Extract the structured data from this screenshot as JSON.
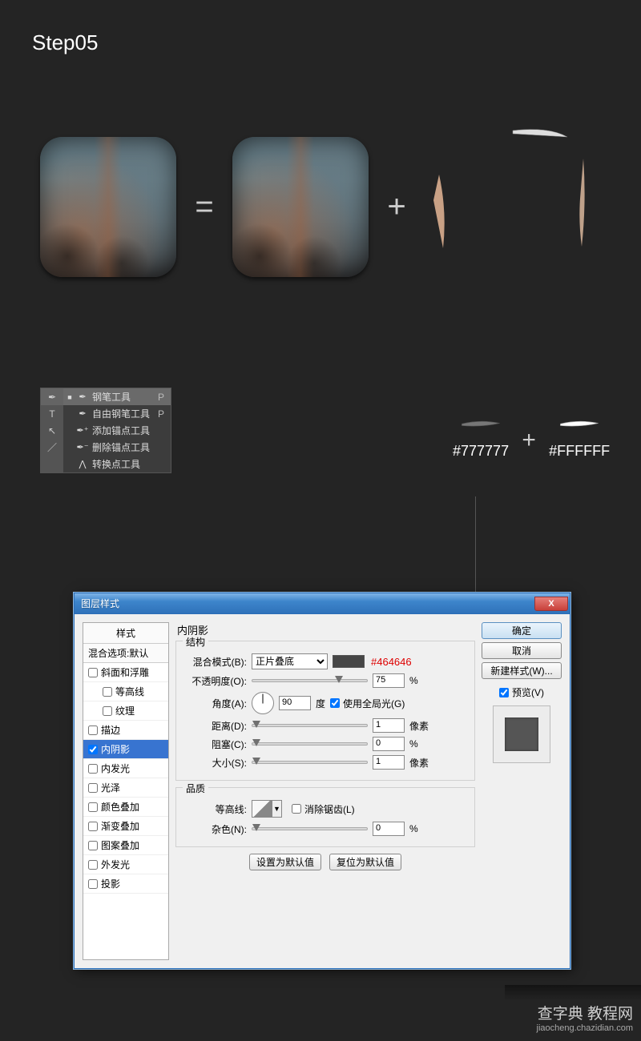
{
  "step_title": "Step05",
  "ops": {
    "equals": "=",
    "plus": "+"
  },
  "tool_flyout": {
    "items": [
      {
        "selected": true,
        "icon": "✒",
        "label": "钢笔工具",
        "shortcut": "P"
      },
      {
        "selected": false,
        "icon": "✒",
        "label": "自由钢笔工具",
        "shortcut": "P"
      },
      {
        "selected": false,
        "icon": "✒⁺",
        "label": "添加锚点工具",
        "shortcut": ""
      },
      {
        "selected": false,
        "icon": "✒⁻",
        "label": "删除锚点工具",
        "shortcut": ""
      },
      {
        "selected": false,
        "icon": "⋀",
        "label": "转换点工具",
        "shortcut": ""
      }
    ],
    "side_icons": [
      "✒",
      "T",
      "↖",
      "／"
    ]
  },
  "swatches": {
    "left": {
      "hex": "#777777",
      "color": "#777777"
    },
    "right": {
      "hex": "#FFFFFF",
      "color": "#ffffff"
    },
    "plus": "+"
  },
  "dialog": {
    "title": "图层样式",
    "close": "X",
    "styles_header": "样式",
    "blend_default": "混合选项:默认",
    "styles": [
      {
        "label": "斜面和浮雕",
        "checked": false,
        "indent": false
      },
      {
        "label": "等高线",
        "checked": false,
        "indent": true
      },
      {
        "label": "纹理",
        "checked": false,
        "indent": true
      },
      {
        "label": "描边",
        "checked": false,
        "indent": false
      },
      {
        "label": "内阴影",
        "checked": true,
        "indent": false,
        "selected": true
      },
      {
        "label": "内发光",
        "checked": false,
        "indent": false
      },
      {
        "label": "光泽",
        "checked": false,
        "indent": false
      },
      {
        "label": "颜色叠加",
        "checked": false,
        "indent": false
      },
      {
        "label": "渐变叠加",
        "checked": false,
        "indent": false
      },
      {
        "label": "图案叠加",
        "checked": false,
        "indent": false
      },
      {
        "label": "外发光",
        "checked": false,
        "indent": false
      },
      {
        "label": "投影",
        "checked": false,
        "indent": false
      }
    ],
    "panel_title": "内阴影",
    "group_structure": "结构",
    "group_quality": "品质",
    "fields": {
      "blend_mode_label": "混合模式(B):",
      "blend_mode_value": "正片叠底",
      "color_annot": "#464646",
      "opacity_label": "不透明度(O):",
      "opacity_value": "75",
      "opacity_unit": "%",
      "angle_label": "角度(A):",
      "angle_value": "90",
      "angle_unit": "度",
      "global_light_label": "使用全局光(G)",
      "distance_label": "距离(D):",
      "distance_value": "1",
      "distance_unit": "像素",
      "choke_label": "阻塞(C):",
      "choke_value": "0",
      "choke_unit": "%",
      "size_label": "大小(S):",
      "size_value": "1",
      "size_unit": "像素",
      "contour_label": "等高线:",
      "antialias_label": "消除锯齿(L)",
      "noise_label": "杂色(N):",
      "noise_value": "0",
      "noise_unit": "%",
      "reset_default": "设置为默认值",
      "restore_default": "复位为默认值"
    },
    "buttons": {
      "ok": "确定",
      "cancel": "取消",
      "new_style": "新建样式(W)...",
      "preview": "预览(V)"
    }
  },
  "watermark": {
    "line1": "查字典 教程网",
    "line2": "jiaocheng.chazidian.com"
  }
}
